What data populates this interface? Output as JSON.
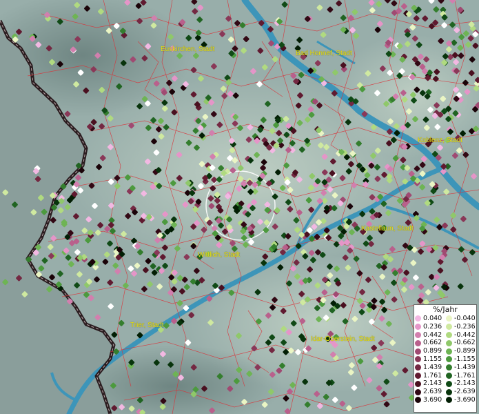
{
  "cities": [
    {
      "id": "euskirchen",
      "name": "Euskirchen, Stadt"
    },
    {
      "id": "bad-honnef",
      "name": "Bad Honnef, Stadt"
    },
    {
      "id": "koblenz",
      "name": "Koblenz, Stadt"
    },
    {
      "id": "kastellaun",
      "name": "Kastellaun, Stadt"
    },
    {
      "id": "wittlich",
      "name": "Wittlich, Stadt"
    },
    {
      "id": "trier",
      "name": "Trier, Stadt"
    },
    {
      "id": "idar-oberstein",
      "name": "Idar-Oberstein, Stadt"
    }
  ],
  "legend": {
    "title": "%/Jahr",
    "positive": [
      {
        "label": "0.040",
        "color": "#f2b8e2"
      },
      {
        "label": "0.236",
        "color": "#e595c8"
      },
      {
        "label": "0.442",
        "color": "#d27fae"
      },
      {
        "label": "0.662",
        "color": "#b9608c"
      },
      {
        "label": "0.899",
        "color": "#a04a72"
      },
      {
        "label": "1.155",
        "color": "#8a3858"
      },
      {
        "label": "1.439",
        "color": "#742842"
      },
      {
        "label": "1.761",
        "color": "#601a30"
      },
      {
        "label": "2.143",
        "color": "#4a1020"
      },
      {
        "label": "2.639",
        "color": "#320814"
      },
      {
        "label": "3.690",
        "color": "#1a0308"
      }
    ],
    "negative": [
      {
        "label": "-0.040",
        "color": "#eaf5c4"
      },
      {
        "label": "-0.236",
        "color": "#cfe9a0"
      },
      {
        "label": "-0.442",
        "color": "#b0da80"
      },
      {
        "label": "-0.662",
        "color": "#8fc86a"
      },
      {
        "label": "-0.899",
        "color": "#6eb454"
      },
      {
        "label": "-1.155",
        "color": "#4c9a3e"
      },
      {
        "label": "-1.439",
        "color": "#347e2e"
      },
      {
        "label": "-1.761",
        "color": "#206422"
      },
      {
        "label": "-2.143",
        "color": "#104a16"
      },
      {
        "label": "-2.639",
        "color": "#08340c"
      },
      {
        "label": "-3.690",
        "color": "#021e04"
      }
    ]
  }
}
